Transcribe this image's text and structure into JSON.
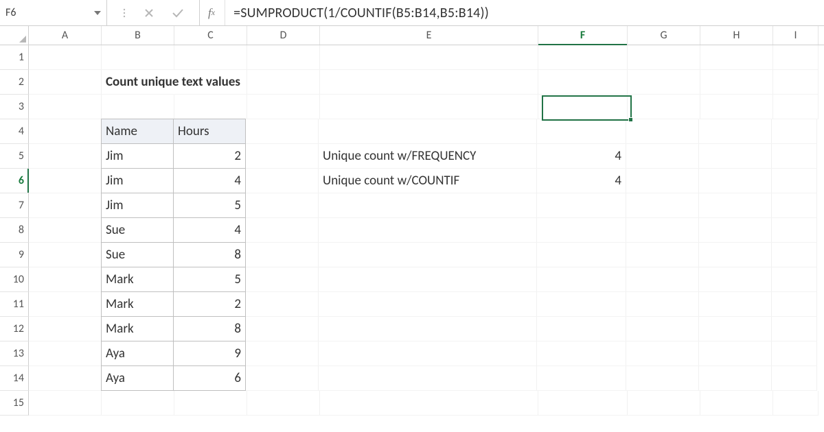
{
  "name_box": "F6",
  "formula": "=SUMPRODUCT(1/COUNTIF(B5:B14,B5:B14))",
  "columns": [
    "A",
    "B",
    "C",
    "D",
    "E",
    "F",
    "G",
    "H",
    "I"
  ],
  "active_column": "F",
  "active_row": 6,
  "title": "Count unique text values",
  "table": {
    "headers": {
      "name": "Name",
      "hours": "Hours"
    },
    "rows": [
      {
        "name": "Jim",
        "hours": 2
      },
      {
        "name": "Jim",
        "hours": 4
      },
      {
        "name": "Jim",
        "hours": 5
      },
      {
        "name": "Sue",
        "hours": 4
      },
      {
        "name": "Sue",
        "hours": 8
      },
      {
        "name": "Mark",
        "hours": 5
      },
      {
        "name": "Mark",
        "hours": 2
      },
      {
        "name": "Mark",
        "hours": 8
      },
      {
        "name": "Aya",
        "hours": 9
      },
      {
        "name": "Aya",
        "hours": 6
      }
    ]
  },
  "labels": {
    "freq": "Unique count w/FREQUENCY",
    "countif": "Unique count w/COUNTIF"
  },
  "results": {
    "freq": 4,
    "countif": 4
  },
  "selection": {
    "cell": "F6"
  }
}
